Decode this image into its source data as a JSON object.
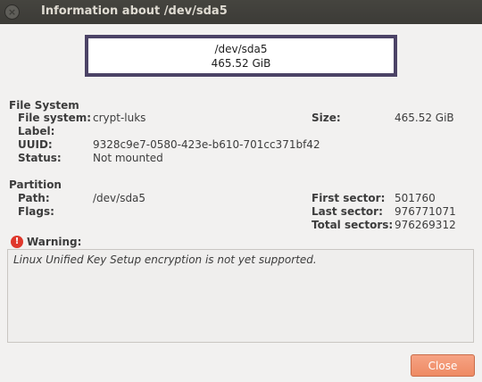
{
  "window": {
    "title": "Information about /dev/sda5",
    "close_glyph": "×"
  },
  "device": {
    "name": "/dev/sda5",
    "size": "465.52 GiB"
  },
  "file_system": {
    "section_title": "File System",
    "fs_label": "File system:",
    "fs_value": "crypt-luks",
    "label_label": "Label:",
    "label_value": "",
    "uuid_label": "UUID:",
    "uuid_value": "9328c9e7-0580-423e-b610-701cc371bf42",
    "status_label": "Status:",
    "status_value": "Not mounted",
    "size_label": "Size:",
    "size_value": "465.52 GiB"
  },
  "partition": {
    "section_title": "Partition",
    "path_label": "Path:",
    "path_value": "/dev/sda5",
    "flags_label": "Flags:",
    "flags_value": "",
    "first_sector_label": "First sector:",
    "first_sector_value": "501760",
    "last_sector_label": "Last sector:",
    "last_sector_value": "976771071",
    "total_sectors_label": "Total sectors:",
    "total_sectors_value": "976269312"
  },
  "warning": {
    "icon": "error-icon",
    "icon_glyph": "!",
    "title": "Warning:",
    "message": "Linux Unified Key Setup encryption is not yet supported."
  },
  "buttons": {
    "close_label": "Close"
  },
  "colors": {
    "titlebar": "#3c3b37",
    "device_border": "#4c4366",
    "close_button": "#ee8a63",
    "warning_icon": "#df382c"
  }
}
